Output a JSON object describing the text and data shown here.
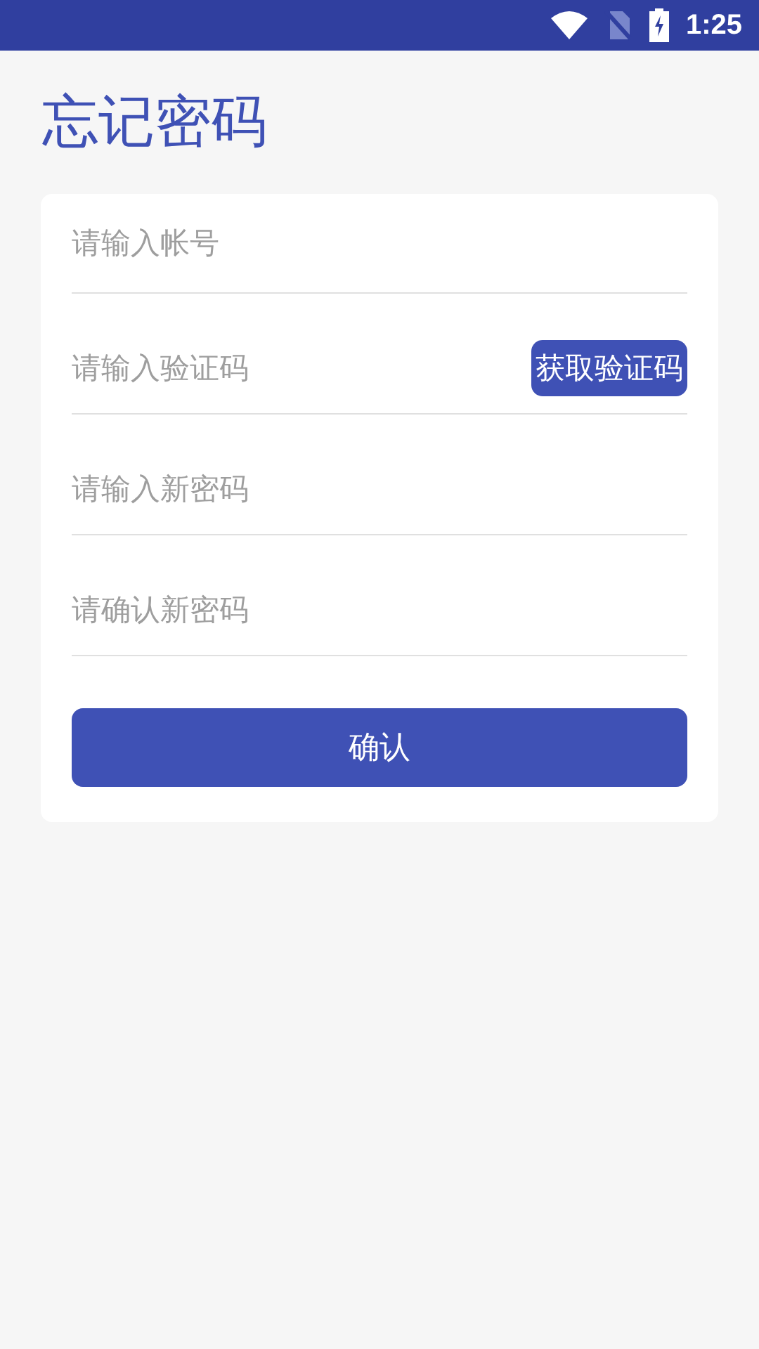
{
  "status_bar": {
    "time": "1:25"
  },
  "title": "忘记密码",
  "fields": [
    {
      "kind": "plain",
      "placeholder": "请输入帐号"
    },
    {
      "kind": "with_button",
      "placeholder": "请输入验证码",
      "button": "获取验证码"
    },
    {
      "kind": "plain",
      "placeholder": "请输入新密码"
    },
    {
      "kind": "plain",
      "placeholder": "请确认新密码"
    }
  ],
  "submit": "确认"
}
